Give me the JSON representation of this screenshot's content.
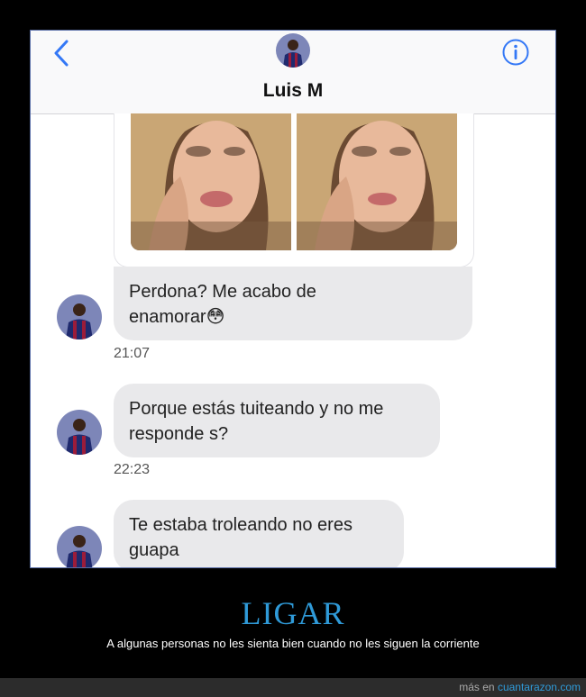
{
  "header": {
    "contact_name": "Luis M",
    "back_icon": "chevron-left-icon",
    "info_icon": "info-icon"
  },
  "messages": [
    {
      "text_line1": "Perdona? Me acabo de",
      "text_line2": "enamorar",
      "emoji": "😳",
      "time": "21:07"
    },
    {
      "text_line1": "Porque estás tuiteando y no me",
      "text_line2": "responde s?",
      "time": "22:23"
    },
    {
      "text_line1": "Te estaba troleando no eres",
      "text_line2": "guapa"
    }
  ],
  "caption": {
    "title": "LIGAR",
    "subtitle": "A algunas personas no les sienta bien cuando no les siguen la corriente"
  },
  "footer": {
    "prefix": "más en",
    "site": "cuantarazon.com"
  },
  "colors": {
    "accent": "#2f9ad8",
    "bubble": "#e9e9eb",
    "ios_blue": "#3478f6"
  }
}
